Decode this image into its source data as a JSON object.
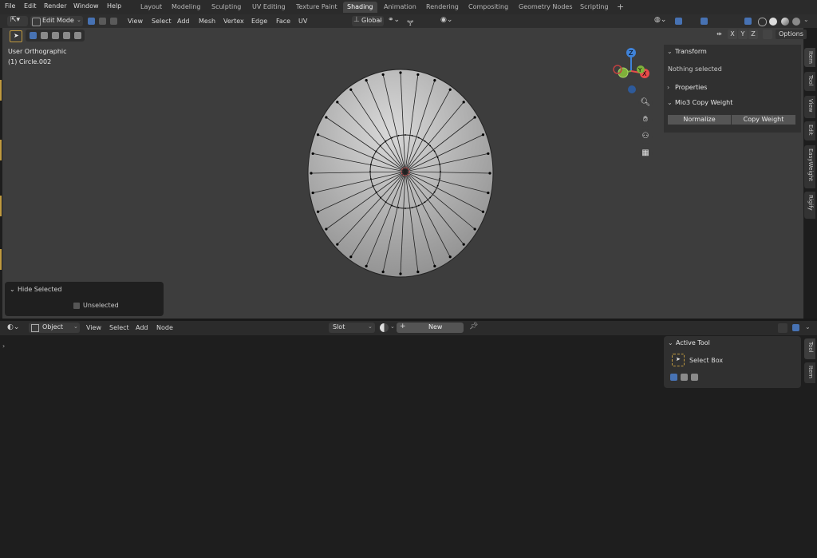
{
  "menu": [
    "File",
    "Edit",
    "Render",
    "Window",
    "Help"
  ],
  "workspaces": [
    "Layout",
    "Modeling",
    "Sculpting",
    "UV Editing",
    "Texture Paint",
    "Shading",
    "Animation",
    "Rendering",
    "Compositing",
    "Geometry Nodes",
    "Scripting",
    "+"
  ],
  "active_workspace": "Shading",
  "viewport_header": {
    "mode": "Edit Mode",
    "menus": [
      "View",
      "Select",
      "Add",
      "Mesh",
      "Vertex",
      "Edge",
      "Face",
      "UV"
    ],
    "transform_orientation": "Global",
    "axes": [
      "X",
      "Y",
      "Z"
    ],
    "options_label": "Options"
  },
  "hud": {
    "view_name": "User Orthographic",
    "object_name": "(1) Circle.002"
  },
  "gizmo": {
    "z": "Z",
    "y": "Y",
    "x": "X"
  },
  "n_panel": {
    "transform_title": "Transform",
    "nothing_selected": "Nothing selected",
    "properties_title": "Properties",
    "copy_weight_title": "Mio3 Copy Weight",
    "normalize_label": "Normalize",
    "copy_weight_label": "Copy Weight"
  },
  "side_tabs_top": [
    "Item",
    "Tool",
    "View",
    "Edit",
    "EasyWeight",
    "Rigify"
  ],
  "hide_panel": {
    "title": "Hide Selected",
    "checkbox_label": "Unselected"
  },
  "node_editor": {
    "object_type": "Object",
    "menus": [
      "View",
      "Select",
      "Add",
      "Node"
    ],
    "slot_label": "Slot",
    "new_label": "New"
  },
  "active_tool_panel": {
    "title": "Active Tool",
    "tool_name": "Select Box"
  },
  "side_tabs_bottom": [
    "Tool",
    "Item"
  ],
  "colors": {
    "accent": "#4772b3",
    "x_axis": "#e84a4a",
    "y_axis": "#7fb03a",
    "z_axis": "#3f82d8",
    "active_tab": "#454545"
  }
}
